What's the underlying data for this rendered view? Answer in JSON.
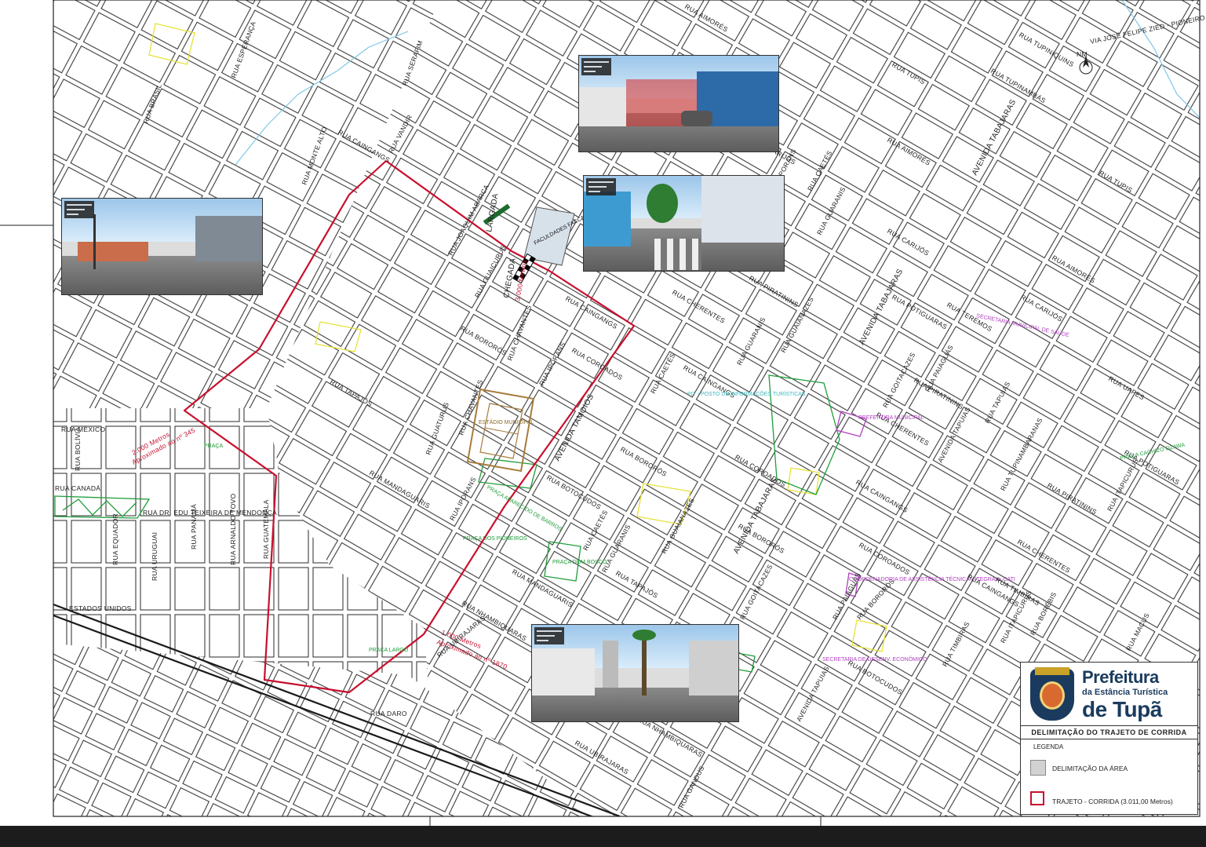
{
  "streets": [
    {
      "name": "RUA CAINGANGS"
    },
    {
      "name": "RUA BRASIL"
    },
    {
      "name": "RUA ESPERANÇA"
    },
    {
      "name": "RUA GUATURUS"
    },
    {
      "name": "RUA CHAVANTES"
    },
    {
      "name": "RUA BORORÓS"
    },
    {
      "name": "AVENIDA TAMOIOS"
    },
    {
      "name": "RUA CAETÉS"
    },
    {
      "name": "RUA GUARANIS"
    },
    {
      "name": "RUA IPORANS"
    },
    {
      "name": "RUA TAPAJÓS"
    },
    {
      "name": "RUA MANDAGUARIS"
    },
    {
      "name": "RUA BOTOCUDOS"
    },
    {
      "name": "RUA NHAMBIQUARAS"
    },
    {
      "name": "RUA UBIRAJARAS"
    },
    {
      "name": "RUA COROADOS"
    },
    {
      "name": "RUA AIMORÉS"
    },
    {
      "name": "AVENIDA TABAJARAS"
    },
    {
      "name": "RUA CARIJÓS"
    },
    {
      "name": "RUA PIRATININS"
    },
    {
      "name": "RUA POTIGUARAS"
    },
    {
      "name": "RUA TEREMOS"
    },
    {
      "name": "RUA GUAIANAZES"
    },
    {
      "name": "RUA CHERENTES"
    },
    {
      "name": "RUA GOITACAZES"
    },
    {
      "name": "RUA TUPIS"
    },
    {
      "name": "RUA TUPINAMBÁS"
    },
    {
      "name": "RUA TUPINIQUINS"
    },
    {
      "name": "RUA GUAICURUS"
    },
    {
      "name": "RUA JOAQUIM ABARCA"
    },
    {
      "name": "RUA MÉXICO"
    },
    {
      "name": "RUA BOLÍVIA"
    },
    {
      "name": "RUA CANADÁ"
    },
    {
      "name": "RUA EQUADOR"
    },
    {
      "name": "RUA URUGUAI"
    },
    {
      "name": "RUA PANAMÁ"
    },
    {
      "name": "RUA ARNALDO TOVO"
    },
    {
      "name": "RUA GUATEMALA"
    },
    {
      "name": "RUA DR. EDU TEIXEIRA DE MENDONÇA"
    },
    {
      "name": "ESTADOS UNIDOS"
    },
    {
      "name": "AVENIDA TAPUIAS"
    },
    {
      "name": "RUA PAIAGUÁS"
    },
    {
      "name": "RUA TIMBIRAS"
    },
    {
      "name": "RUA ITAPICURUS"
    },
    {
      "name": "RUA BORÉBIS"
    },
    {
      "name": "RUA MACUS"
    },
    {
      "name": "RUA UAPES"
    },
    {
      "name": "RUA TUPINAMBARANAS"
    },
    {
      "name": "VIA JOSÉ FELIPE ZIED - PIONEIRO"
    },
    {
      "name": "RUA GANDUS"
    },
    {
      "name": "RUA DARO"
    },
    {
      "name": "RUA SERAFIM"
    },
    {
      "name": "RUA VANDIR"
    },
    {
      "name": "RUA MONTE ALTO"
    },
    {
      "name": "RUA TAPUIAS"
    }
  ],
  "route": {
    "start_label": "LARGADA",
    "finish_label": "CHEGADA",
    "finish_distance": "3.000 Metros",
    "marker_2000_a": "2.000 Metros",
    "marker_2000_b": "Aproximado ao nº 345",
    "marker_1000_a": "1.000 Metros",
    "marker_1000_b": "Aproximado ao nº 1870"
  },
  "places": [
    {
      "name": "FACULDADES FACCAT",
      "color": "#111111"
    },
    {
      "name": "PRAÇA APARECIDO DE BARROS",
      "color": "#1e9e3a"
    },
    {
      "name": "PRAÇA DOM BOSCO",
      "color": "#1e9e3a"
    },
    {
      "name": "PRAÇA DOS PIONEIROS",
      "color": "#1e9e3a"
    },
    {
      "name": "PRAÇA CACHIZO OZAWA",
      "color": "#1e9e3a"
    },
    {
      "name": "PRAÇA LARGO",
      "color": "#1e9e3a"
    },
    {
      "name": "SECRETARIA MUNICIPAL DE SAÚDE",
      "color": "#b040c0"
    },
    {
      "name": "PREFEITURA MUNICIPAL",
      "color": "#b040c0"
    },
    {
      "name": "SECRETARIA DE DESENV. ECONÔMICO",
      "color": "#b040c0"
    },
    {
      "name": "COORDENADORIA DE ASSISTÊNCIA TÉCNICA INTEGRAL - CATI",
      "color": "#b040c0"
    },
    {
      "name": "ESTÁDIO MUNICIPAL",
      "color": "#8a6a2a"
    },
    {
      "name": "PIT - POSTO DE INFORMAÇÕES TURÍSTICAS",
      "color": "#3fb8c2"
    },
    {
      "name": "PRAÇA",
      "color": "#1e9e3a"
    }
  ],
  "north_label": "NM",
  "legend": {
    "brand_line1": "Prefeitura",
    "brand_line2": "da Estância Turística",
    "brand_line3": "de Tupã",
    "subtitle": "DELIMITAÇÃO DO TRAJETO DE CORRIDA",
    "heading": "LEGENDA",
    "item_area": "DELIMITAÇÃO DA ÁREA",
    "item_route": "TRAJETO - CORRIDA (3.011,00 Metros)"
  },
  "colors": {
    "route": "#c8102e",
    "park": "#1e9e3a",
    "public_building": "#b040c0",
    "highlight": "#f3ee54",
    "stadium": "#8a6a2a",
    "water": "#7ec8e8",
    "brand": "#1a3b5e"
  }
}
